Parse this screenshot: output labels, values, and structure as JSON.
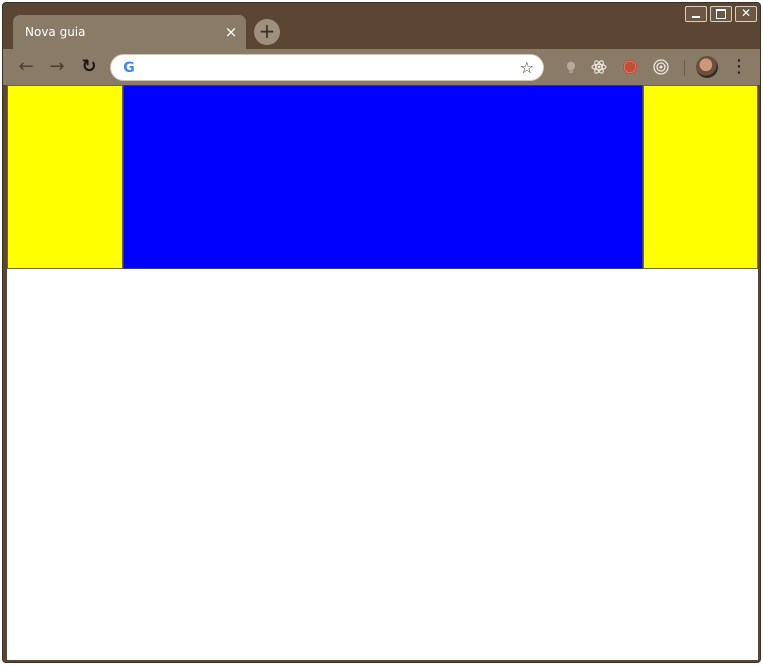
{
  "tab": {
    "title": "Nova guia",
    "close_glyph": "×"
  },
  "new_tab": {
    "glyph": "+"
  },
  "window_controls": {
    "close_glyph": "✕"
  },
  "toolbar": {
    "back_glyph": "←",
    "forward_glyph": "→",
    "reload_glyph": "↻",
    "search_logo": "G",
    "address_value": "",
    "star_glyph": "☆",
    "menu_glyph": "⋮",
    "extensions": [
      "bulb-icon",
      "react-icon",
      "stop-icon",
      "target-icon"
    ]
  },
  "page": {
    "blocks": [
      {
        "name": "left-block",
        "color": "#ffff00"
      },
      {
        "name": "center-block",
        "color": "#0000ff"
      },
      {
        "name": "right-block",
        "color": "#ffff00"
      }
    ]
  },
  "theme": {
    "frame": "#5a4632",
    "tab_active": "#8a7a68",
    "google_blue": "#4285f4"
  }
}
